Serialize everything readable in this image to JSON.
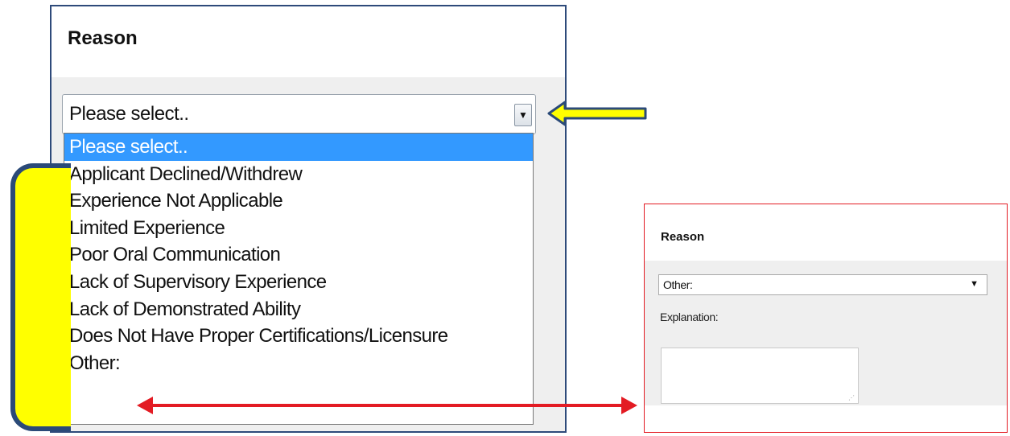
{
  "left_form": {
    "title": "Reason",
    "select_value": "Please select..",
    "dropdown_arrow": "▼",
    "options": [
      "Please select..",
      "Applicant Declined/Withdrew",
      "Experience Not Applicable",
      "Limited Experience",
      "Poor Oral Communication",
      "Lack of Supervisory Experience",
      "Lack of Demonstrated Ability",
      "Does Not Have Proper Certifications/Licensure",
      "Other:"
    ],
    "selected_index": 0
  },
  "right_form": {
    "title": "Reason",
    "select_value": "Other:",
    "dropdown_arrow": "▼",
    "explanation_label": "Explanation:",
    "explanation_value": ""
  },
  "annotations": {
    "yellow_arrow_color": "#ffff00",
    "yellow_arrow_outline": "#2b4a78",
    "bracket_color": "#ffff00",
    "red_arrow_color": "#e31b23",
    "right_panel_border": "#e31b23",
    "left_panel_border": "#2e4a7a"
  }
}
